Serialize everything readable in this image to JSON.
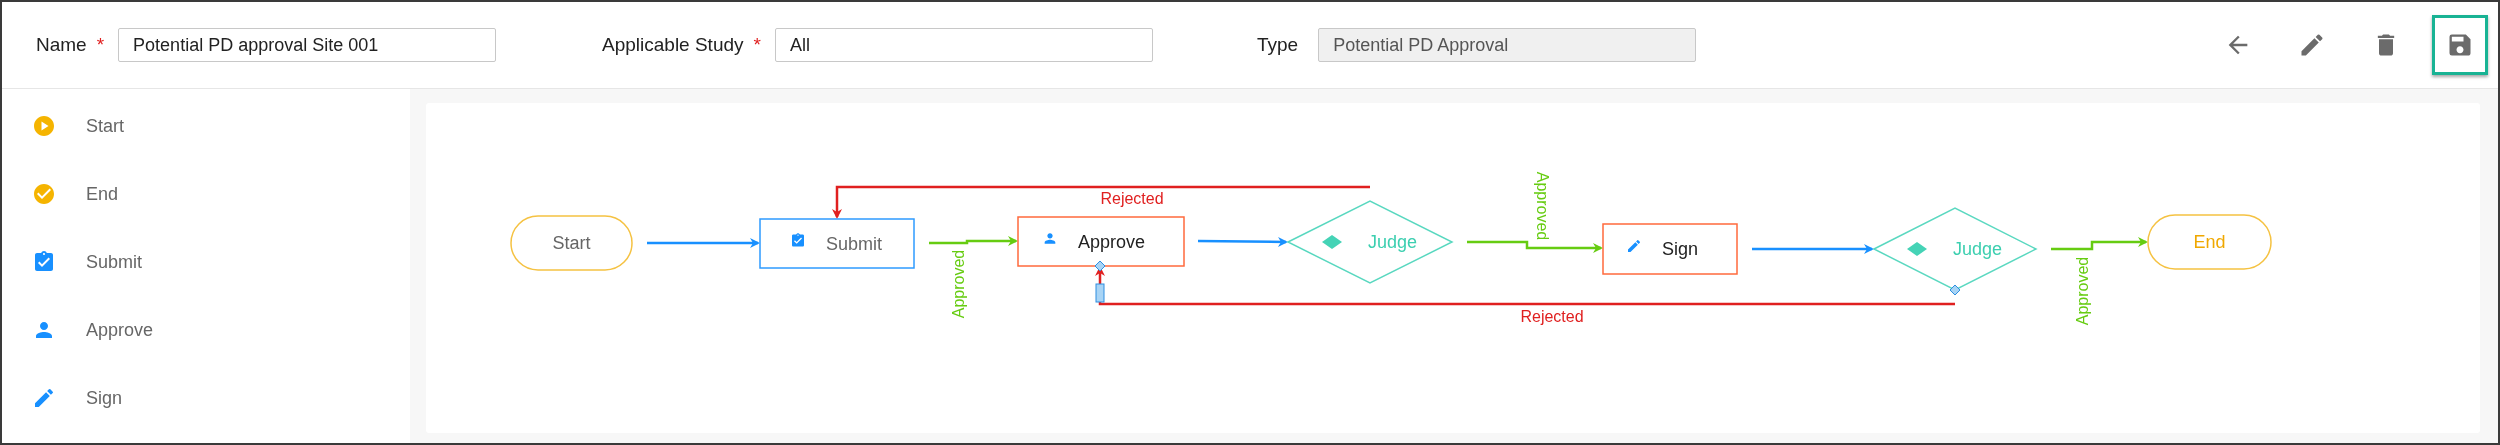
{
  "header": {
    "fields": [
      {
        "label": "Name",
        "required_mark": "*",
        "value": "Potential PD approval Site 001",
        "disabled": false
      },
      {
        "label": "Applicable Study",
        "required_mark": "*",
        "value": "All",
        "disabled": false
      },
      {
        "label": "Type",
        "value": "Potential PD Approval",
        "disabled": true
      }
    ],
    "toolbar": [
      {
        "kind": "back",
        "selected": false
      },
      {
        "kind": "edit",
        "selected": false
      },
      {
        "kind": "delete",
        "selected": false
      },
      {
        "kind": "save",
        "selected": true
      }
    ]
  },
  "palette": [
    {
      "kind": "start",
      "label": "Start"
    },
    {
      "kind": "end",
      "label": "End"
    },
    {
      "kind": "submit",
      "label": "Submit"
    },
    {
      "kind": "approve",
      "label": "Approve"
    },
    {
      "kind": "sign",
      "label": "Sign"
    }
  ],
  "diagram": {
    "nodes": [
      {
        "kind": "start",
        "label": "Start"
      },
      {
        "kind": "submit",
        "label": "Submit"
      },
      {
        "kind": "approve",
        "label": "Approve"
      },
      {
        "kind": "judge",
        "label": "Judge"
      },
      {
        "kind": "sign",
        "label": "Sign"
      },
      {
        "kind": "judge",
        "label": "Judge"
      },
      {
        "kind": "end",
        "label": "End"
      }
    ],
    "edges": [
      {
        "kind": "flow",
        "selected": false
      },
      {
        "kind": "approved",
        "label": "Approved",
        "selected": false
      },
      {
        "kind": "flow",
        "selected": false
      },
      {
        "kind": "rejected",
        "label": "Rejected",
        "selected": false
      },
      {
        "kind": "approved",
        "label": "Approved",
        "selected": false
      },
      {
        "kind": "rejected",
        "label": "Rejected",
        "selected": true
      },
      {
        "kind": "flow",
        "selected": false
      },
      {
        "kind": "approved",
        "label": "Approved",
        "selected": false
      }
    ]
  }
}
